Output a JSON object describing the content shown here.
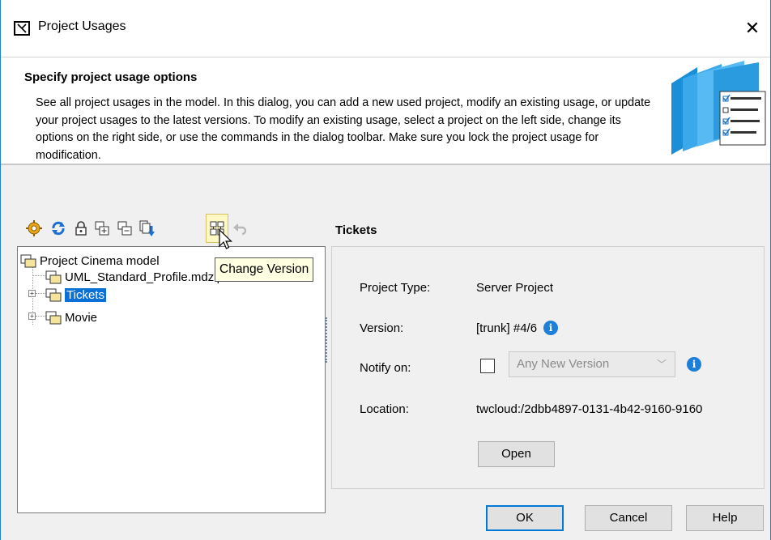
{
  "window": {
    "title": "Project Usages",
    "close_glyph": "✕",
    "title_icon": "window-icon"
  },
  "header": {
    "title": "Specify project usage options",
    "description": "See all project usages in the model. In this dialog, you can add a new used project, modify an existing usage, or update your project usages to the latest versions. To modify an existing usage, select a project on the left side, change its options on the right side, or use the commands in the dialog toolbar. Make sure you lock the project usage for modification.",
    "graphic": "folders-checklist-graphic"
  },
  "toolbar": {
    "buttons": [
      {
        "icon": "gear-icon",
        "glyph": "⚙"
      },
      {
        "icon": "refresh-icon",
        "glyph": "↻"
      },
      {
        "icon": "lock-icon",
        "glyph": "🔒"
      },
      {
        "icon": "import-icon",
        "glyph": "⊞"
      },
      {
        "icon": "export-icon",
        "glyph": "⊟"
      },
      {
        "icon": "share-icon",
        "glyph": "⇩"
      },
      {
        "icon": "change-version-icon",
        "glyph": "⇆"
      },
      {
        "icon": "undo-icon",
        "glyph": "↶"
      }
    ],
    "tooltip": "Change Version"
  },
  "tree": {
    "root": "Project Cinema model",
    "items": [
      {
        "label": "UML_Standard_Profile.mdzip",
        "expandable": false,
        "selected": false
      },
      {
        "label": "Tickets",
        "expandable": true,
        "selected": true
      },
      {
        "label": "Movie",
        "expandable": true,
        "selected": false
      }
    ]
  },
  "details": {
    "title": "Tickets",
    "project_type_label": "Project Type:",
    "project_type_value": "Server Project",
    "version_label": "Version:",
    "version_value": "[trunk] #4/6",
    "notify_label": "Notify on:",
    "notify_checked": false,
    "notify_option": "Any New Version",
    "location_label": "Location:",
    "location_value": "twcloud:/2dbb4897-0131-4b42-9160-9160",
    "open_button": "Open"
  },
  "footer": {
    "ok": "OK",
    "cancel": "Cancel",
    "help": "Help"
  },
  "colors": {
    "accent": "#1883d7",
    "selection": "#0a6fd6",
    "tooltip_bg": "#ffffe1",
    "folder": "#f5e49c",
    "info": "#1e7fd9"
  }
}
